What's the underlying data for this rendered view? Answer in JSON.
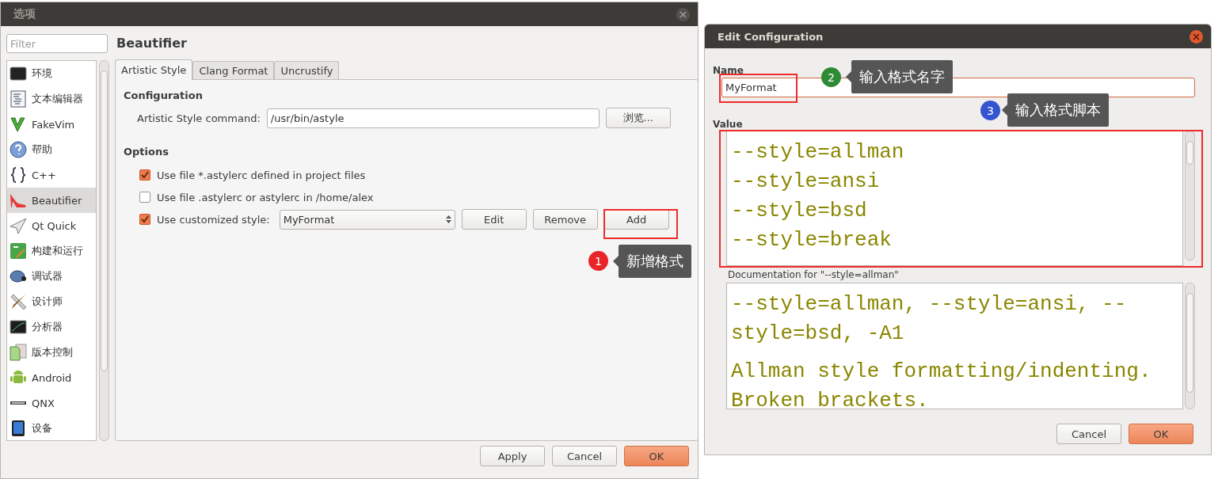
{
  "options_dialog": {
    "title": "选项",
    "filter": {
      "placeholder": "Filter"
    },
    "categories": [
      {
        "label": "环境",
        "selected": false
      },
      {
        "label": "文本编辑器",
        "selected": false
      },
      {
        "label": "FakeVim",
        "selected": false
      },
      {
        "label": "帮助",
        "selected": false
      },
      {
        "label": "C++",
        "selected": false
      },
      {
        "label": "Beautifier",
        "selected": true
      },
      {
        "label": "Qt Quick",
        "selected": false
      },
      {
        "label": "构建和运行",
        "selected": false
      },
      {
        "label": "调试器",
        "selected": false
      },
      {
        "label": "设计师",
        "selected": false
      },
      {
        "label": "分析器",
        "selected": false
      },
      {
        "label": "版本控制",
        "selected": false
      },
      {
        "label": "Android",
        "selected": false
      },
      {
        "label": "QNX",
        "selected": false
      },
      {
        "label": "设备",
        "selected": false
      }
    ],
    "page_title": "Beautifier",
    "tabs": [
      {
        "label": "Artistic Style",
        "selected": true
      },
      {
        "label": "Clang Format",
        "selected": false
      },
      {
        "label": "Uncrustify",
        "selected": false
      }
    ],
    "configuration": {
      "heading": "Configuration",
      "command_label": "Artistic Style command:",
      "command_value": "/usr/bin/astyle",
      "browse_button": "浏览..."
    },
    "options": {
      "heading": "Options",
      "items": [
        {
          "label": "Use file *.astylerc defined in project files",
          "checked": true
        },
        {
          "label": "Use file .astylerc or astylerc in /home/alex",
          "checked": false
        },
        {
          "label": "Use customized style:",
          "checked": true
        }
      ],
      "style_select": "MyFormat",
      "style_buttons": [
        "Edit",
        "Remove",
        "Add"
      ]
    },
    "buttons": [
      {
        "label": "Apply",
        "default": false
      },
      {
        "label": "Cancel",
        "default": false
      },
      {
        "label": "OK",
        "default": true
      }
    ]
  },
  "edit_dialog": {
    "title": "Edit Configuration",
    "name_label": "Name",
    "name_value": "MyFormat",
    "value_label": "Value",
    "value_lines": [
      "--style=allman",
      "--style=ansi",
      "--style=bsd",
      "--style=break"
    ],
    "doc_label": "Documentation for \"--style=allman\"",
    "doc_paragraphs": [
      "--style=allman, --style=ansi, --style=bsd, -A1",
      "Allman style formatting/indenting. Broken brackets."
    ],
    "buttons": [
      {
        "label": "Cancel",
        "default": false
      },
      {
        "label": "OK",
        "default": true
      }
    ]
  },
  "annotations": [
    {
      "number": "1",
      "text": "新增格式",
      "color": "#e8262a"
    },
    {
      "number": "2",
      "text": "输入格式名字",
      "color": "#2e8a35"
    },
    {
      "number": "3",
      "text": "输入格式脚本",
      "color": "#3554d1"
    }
  ]
}
